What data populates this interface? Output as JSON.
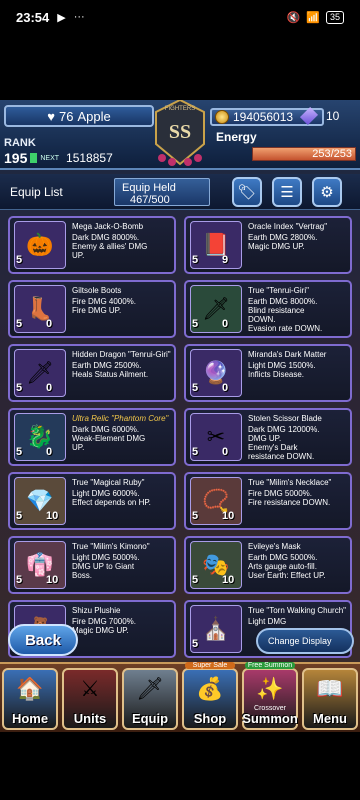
{
  "status_bar": {
    "time": "23:54",
    "battery": "35",
    "extra": "···"
  },
  "header": {
    "player_name": "Apple",
    "player_hearts": "76",
    "rank_label": "RANK",
    "rank_value": "195",
    "next_label": "NEXT",
    "next_value": "1518857",
    "emblem_text": "SS",
    "emblem_top": "FIGHTERS",
    "gold": "194056013",
    "gems": "10",
    "energy_label": "Energy",
    "energy_value": "253/253",
    "energy_fraction": 1.0
  },
  "equip_bar": {
    "title": "Equip List",
    "held_label": "Equip Held",
    "held_value": "467/500"
  },
  "cards": [
    {
      "name": "Mega Jack-O-Bomb",
      "desc": [
        "Dark DMG 8000%.",
        "Enemy & allies' DMG",
        "UP."
      ],
      "lvl": "5",
      "count": "",
      "glyph": "🎃",
      "color": "#3a2a66"
    },
    {
      "name": "Oracle Index \"Vertrag\"",
      "desc": [
        "Earth DMG 2800%.",
        "Magic DMG UP."
      ],
      "lvl": "5",
      "count": "9",
      "glyph": "📕",
      "color": "#3a2a66"
    },
    {
      "name": "Giltsole Boots",
      "desc": [
        "Fire DMG 4000%.",
        "Fire DMG UP."
      ],
      "lvl": "5",
      "count": "0",
      "glyph": "👢",
      "color": "#3a2a66"
    },
    {
      "name": "True \"Tenrui-Giri\"",
      "desc": [
        "Earth DMG 8000%.",
        "Blind resistance",
        "DOWN.",
        "Evasion rate DOWN."
      ],
      "lvl": "5",
      "count": "0",
      "glyph": "🗡",
      "color": "#2a4a3a"
    },
    {
      "name": "Hidden Dragon \"Tenrui-Giri\"",
      "desc": [
        "Earth DMG 2500%.",
        "Heals Status Ailment."
      ],
      "lvl": "5",
      "count": "0",
      "glyph": "🗡",
      "color": "#3a2a66"
    },
    {
      "name": "Miranda's Dark Matter",
      "desc": [
        "Light DMG 1500%.",
        "Inflicts Disease."
      ],
      "lvl": "5",
      "count": "0",
      "glyph": "🔮",
      "color": "#3a2a66"
    },
    {
      "name": "Ultra Relic \"Phantom Core\"",
      "desc": [
        "Dark DMG 6000%.",
        "Weak-Element DMG",
        "UP."
      ],
      "lvl": "5",
      "count": "0",
      "glyph": "🐉",
      "color": "#243a5a",
      "relic": true
    },
    {
      "name": "Stolen Scissor Blade",
      "desc": [
        "Dark DMG 12000%.",
        "DMG UP.",
        "Enemy's Dark",
        "resistance DOWN."
      ],
      "lvl": "5",
      "count": "0",
      "glyph": "✂",
      "color": "#3a2a66"
    },
    {
      "name": "True \"Magical Ruby\"",
      "desc": [
        "Light DMG 6000%.",
        "Effect depends on HP."
      ],
      "lvl": "5",
      "count": "10",
      "glyph": "💎",
      "color": "#5a4a3a"
    },
    {
      "name": "True \"Milim's Necklace\"",
      "desc": [
        "Fire DMG 5000%.",
        "Fire resistance DOWN."
      ],
      "lvl": "5",
      "count": "10",
      "glyph": "📿",
      "color": "#5a3a3a"
    },
    {
      "name": "True \"Milim's Kimono\"",
      "desc": [
        "Light DMG 5000%.",
        "DMG UP to Giant",
        "Boss."
      ],
      "lvl": "5",
      "count": "10",
      "glyph": "👘",
      "color": "#5a3a4a"
    },
    {
      "name": "Evileye's Mask",
      "desc": [
        "Earth DMG 5000%.",
        "Arts gauge auto-fill.",
        "User Earth: Effect UP."
      ],
      "lvl": "5",
      "count": "10",
      "glyph": "🎭",
      "color": "#3a4a3a"
    },
    {
      "name": "Shizu Plushie",
      "desc": [
        "Fire DMG 7000%.",
        "Magic DMG UP."
      ],
      "lvl": "5",
      "count": "",
      "glyph": "🧸",
      "color": "#3a2a66"
    },
    {
      "name": "True \"Torn Walking Church\"",
      "desc": [
        "Light DMG"
      ],
      "lvl": "5",
      "count": "",
      "glyph": "⛪",
      "color": "#3a2a66"
    }
  ],
  "buttons": {
    "back": "Back",
    "change_display": "Change Display"
  },
  "nav": [
    {
      "label": "Home",
      "glyph": "🏠",
      "bg": "#3a6fb5"
    },
    {
      "label": "Units",
      "glyph": "⚔",
      "bg": "#7a2a2a"
    },
    {
      "label": "Equip",
      "glyph": "🗡",
      "bg": "#6f7f8f"
    },
    {
      "label": "Shop",
      "glyph": "💰",
      "bg": "#3a6fb5",
      "badge": "Super Sale",
      "badge_color": "#d06a1a"
    },
    {
      "label": "Summon",
      "glyph": "✨",
      "bg": "#a83a6a",
      "badge": "Free Summon",
      "badge_color": "#2a9a3a",
      "sub": "Crossover"
    },
    {
      "label": "Menu",
      "glyph": "📖",
      "bg": "#b5853a"
    }
  ]
}
